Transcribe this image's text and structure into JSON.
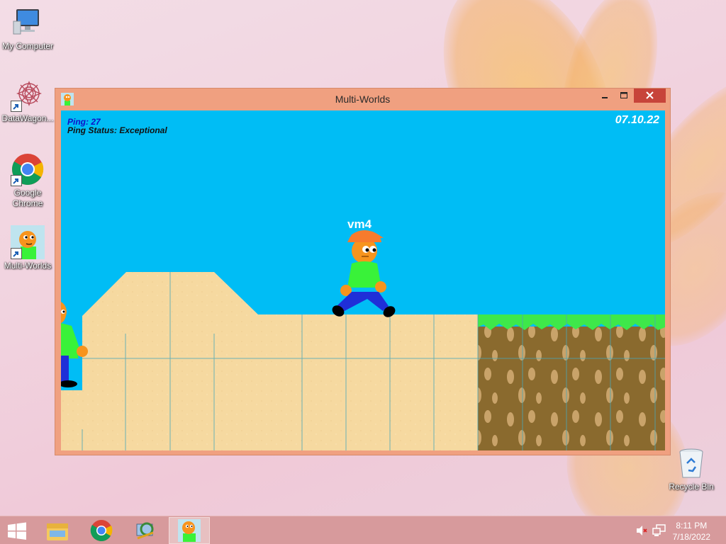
{
  "desktop": {
    "icons": [
      {
        "label": "My Computer"
      },
      {
        "label": "DataWagon..."
      },
      {
        "label": "Google Chrome"
      },
      {
        "label": "Multi-Worlds"
      },
      {
        "label": "Recycle Bin"
      }
    ]
  },
  "window": {
    "title": "Multi-Worlds",
    "controls": {
      "minimize": "minimize-icon",
      "maximize": "maximize-icon",
      "close": "close-icon"
    }
  },
  "game": {
    "ping": "Ping: 27",
    "ping_status": "Ping Status: Exceptional",
    "date": "07.10.22",
    "player_name": "vm4",
    "colors": {
      "sky": "#00bdf5",
      "sand": "#f6d9a0",
      "dirt": "#8a6a2e",
      "grass": "#3ee84a",
      "shirt": "#39f239",
      "pants": "#1f2fd8",
      "skin": "#f7941d",
      "cap": "#f77b2d"
    }
  },
  "taskbar": {
    "items": [
      "start-icon",
      "file-explorer-icon",
      "chrome-icon",
      "network-app-icon",
      "multi-worlds-icon"
    ],
    "tray": [
      "volume-muted-icon",
      "network-icon"
    ],
    "time": "8:11 PM",
    "date": "7/18/2022"
  }
}
